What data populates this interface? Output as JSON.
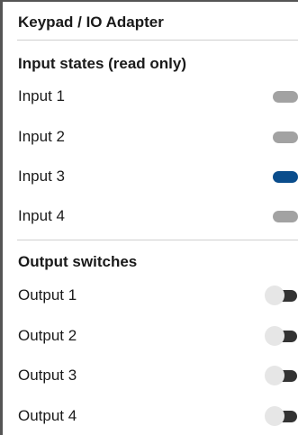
{
  "app": {
    "title": "Keypad / IO Adapter"
  },
  "colors": {
    "indicator_off": "#a2a2a2",
    "indicator_on": "#0a4d8c",
    "switch_track": "#333333",
    "switch_thumb": "#e6e6e6"
  },
  "inputs": {
    "title": "Input states (read only)",
    "items": [
      {
        "label": "Input 1",
        "state": "off"
      },
      {
        "label": "Input 2",
        "state": "off"
      },
      {
        "label": "Input 3",
        "state": "on"
      },
      {
        "label": "Input 4",
        "state": "off"
      }
    ]
  },
  "outputs": {
    "title": "Output switches",
    "items": [
      {
        "label": "Output 1",
        "state": "off"
      },
      {
        "label": "Output 2",
        "state": "off"
      },
      {
        "label": "Output 3",
        "state": "off"
      },
      {
        "label": "Output 4",
        "state": "off"
      }
    ]
  }
}
